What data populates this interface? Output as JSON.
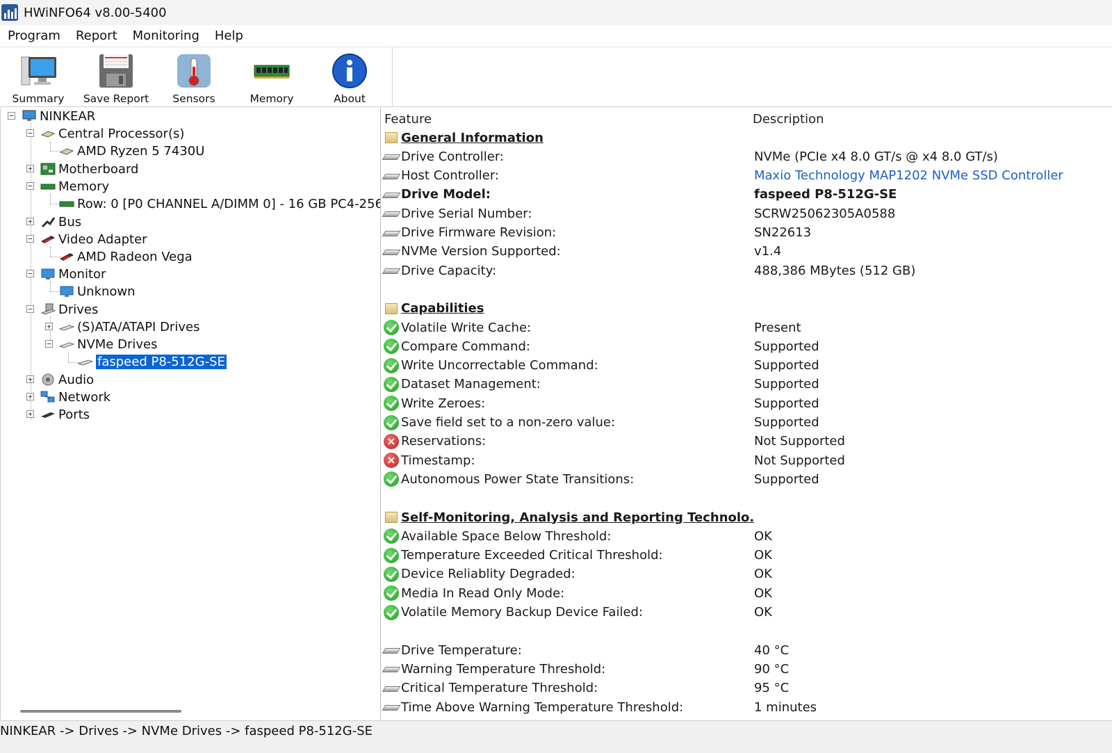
{
  "window": {
    "title": "HWiNFO64 v8.00-5400"
  },
  "menu": [
    "Program",
    "Report",
    "Monitoring",
    "Help"
  ],
  "toolbar": [
    {
      "label": "Summary",
      "icon": "computer-monitor-icon"
    },
    {
      "label": "Save Report",
      "icon": "floppy-disk-icon"
    },
    {
      "label": "Sensors",
      "icon": "thermometer-icon"
    },
    {
      "label": "Memory",
      "icon": "memory-module-icon"
    },
    {
      "label": "About",
      "icon": "info-icon"
    }
  ],
  "tree": [
    {
      "label": "NINKEAR",
      "icon": "computer-icon",
      "expander": "−"
    },
    {
      "label": "Central Processor(s)",
      "icon": "cpu-icon",
      "expander": "−"
    },
    {
      "label": "AMD Ryzen 5 7430U",
      "icon": "cpu-icon",
      "expander": ""
    },
    {
      "label": "Motherboard",
      "icon": "motherboard-icon",
      "expander": "+"
    },
    {
      "label": "Memory",
      "icon": "memory-icon",
      "expander": "−"
    },
    {
      "label": "Row: 0 [P0 CHANNEL A/DIMM 0] - 16 GB PC4-256",
      "icon": "memory-icon",
      "expander": ""
    },
    {
      "label": "Bus",
      "icon": "bus-icon",
      "expander": "+"
    },
    {
      "label": "Video Adapter",
      "icon": "gpu-icon",
      "expander": "−"
    },
    {
      "label": "AMD Radeon Vega",
      "icon": "gpu-icon",
      "expander": ""
    },
    {
      "label": "Monitor",
      "icon": "monitor-icon",
      "expander": "−"
    },
    {
      "label": "Unknown",
      "icon": "monitor-icon",
      "expander": ""
    },
    {
      "label": "Drives",
      "icon": "drives-icon",
      "expander": "−"
    },
    {
      "label": "(S)ATA/ATAPI Drives",
      "icon": "drive-icon",
      "expander": "+"
    },
    {
      "label": "NVMe Drives",
      "icon": "drive-icon",
      "expander": "−"
    },
    {
      "label": "faspeed P8-512G-SE",
      "icon": "drive-icon",
      "expander": "",
      "selected": true
    },
    {
      "label": "Audio",
      "icon": "speaker-icon",
      "expander": "+"
    },
    {
      "label": "Network",
      "icon": "network-icon",
      "expander": "+"
    },
    {
      "label": "Ports",
      "icon": "port-icon",
      "expander": "+"
    }
  ],
  "details": {
    "columns": {
      "feature": "Feature",
      "description": "Description"
    },
    "rows": [
      {
        "type": "section",
        "feature": "General Information",
        "description": ""
      },
      {
        "type": "drive",
        "feature": "Drive Controller:",
        "description": "NVMe (PCIe x4 8.0 GT/s @ x4 8.0 GT/s)"
      },
      {
        "type": "drive",
        "feature": "Host Controller:",
        "description": "Maxio Technology MAP1202 NVMe SSD Controller",
        "link": true
      },
      {
        "type": "drive",
        "feature": "Drive Model:",
        "description": "faspeed P8-512G-SE",
        "bold": true
      },
      {
        "type": "drive",
        "feature": "Drive Serial Number:",
        "description": "SCRW25062305A0588"
      },
      {
        "type": "drive",
        "feature": "Drive Firmware Revision:",
        "description": "SN22613"
      },
      {
        "type": "drive",
        "feature": "NVMe Version Supported:",
        "description": "v1.4"
      },
      {
        "type": "drive",
        "feature": "Drive Capacity:",
        "description": "488,386 MBytes (512 GB)"
      },
      {
        "type": "blank",
        "feature": "",
        "description": ""
      },
      {
        "type": "section",
        "feature": "Capabilities",
        "description": ""
      },
      {
        "type": "ok",
        "feature": "Volatile Write Cache:",
        "description": "Present"
      },
      {
        "type": "ok",
        "feature": "Compare Command:",
        "description": "Supported"
      },
      {
        "type": "ok",
        "feature": "Write Uncorrectable Command:",
        "description": "Supported"
      },
      {
        "type": "ok",
        "feature": "Dataset Management:",
        "description": "Supported"
      },
      {
        "type": "ok",
        "feature": "Write Zeroes:",
        "description": "Supported"
      },
      {
        "type": "ok",
        "feature": "Save field set to a non-zero value:",
        "description": "Supported"
      },
      {
        "type": "err",
        "feature": "Reservations:",
        "description": "Not Supported"
      },
      {
        "type": "err",
        "feature": "Timestamp:",
        "description": "Not Supported"
      },
      {
        "type": "ok",
        "feature": "Autonomous Power State Transitions:",
        "description": "Supported"
      },
      {
        "type": "blank",
        "feature": "",
        "description": ""
      },
      {
        "type": "section",
        "feature": "Self-Monitoring, Analysis and Reporting Technolo...",
        "description": ""
      },
      {
        "type": "ok",
        "feature": "Available Space Below Threshold:",
        "description": "OK"
      },
      {
        "type": "ok",
        "feature": "Temperature Exceeded Critical Threshold:",
        "description": "OK"
      },
      {
        "type": "ok",
        "feature": "Device Reliablity Degraded:",
        "description": "OK"
      },
      {
        "type": "ok",
        "feature": "Media In Read Only Mode:",
        "description": "OK"
      },
      {
        "type": "ok",
        "feature": "Volatile Memory Backup Device Failed:",
        "description": "OK"
      },
      {
        "type": "blank",
        "feature": "",
        "description": ""
      },
      {
        "type": "drive",
        "feature": "Drive Temperature:",
        "description": "40 °C"
      },
      {
        "type": "drive",
        "feature": "Warning Temperature Threshold:",
        "description": "90 °C"
      },
      {
        "type": "drive",
        "feature": "Critical Temperature Threshold:",
        "description": "95 °C"
      },
      {
        "type": "drive",
        "feature": "Time Above Warning Temperature Threshold:",
        "description": "1 minutes"
      }
    ]
  },
  "statusbar": {
    "path": "NINKEAR -> Drives -> NVMe Drives -> faspeed P8-512G-SE"
  },
  "colors": {
    "selection": "#0a64d6",
    "link": "#1f5fc9",
    "ok": "#1f9a1f",
    "error": "#c01d1d"
  }
}
